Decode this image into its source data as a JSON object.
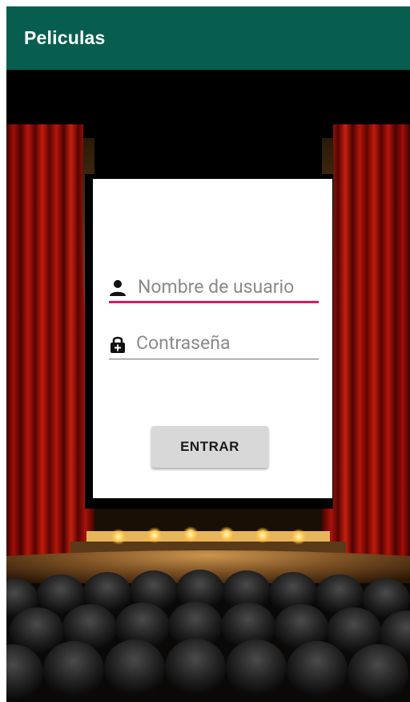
{
  "app": {
    "title": "Peliculas",
    "accent_color": "#075e4f"
  },
  "login": {
    "username_placeholder": "Nombre de usuario",
    "username_value": "",
    "password_placeholder": "Contraseña",
    "password_value": "",
    "submit_label": "ENTRAR",
    "username_icon": "person-icon",
    "password_icon": "lock-icon",
    "focus_color": "#d81b60"
  },
  "background": {
    "scene": "theater-stage-icon"
  }
}
